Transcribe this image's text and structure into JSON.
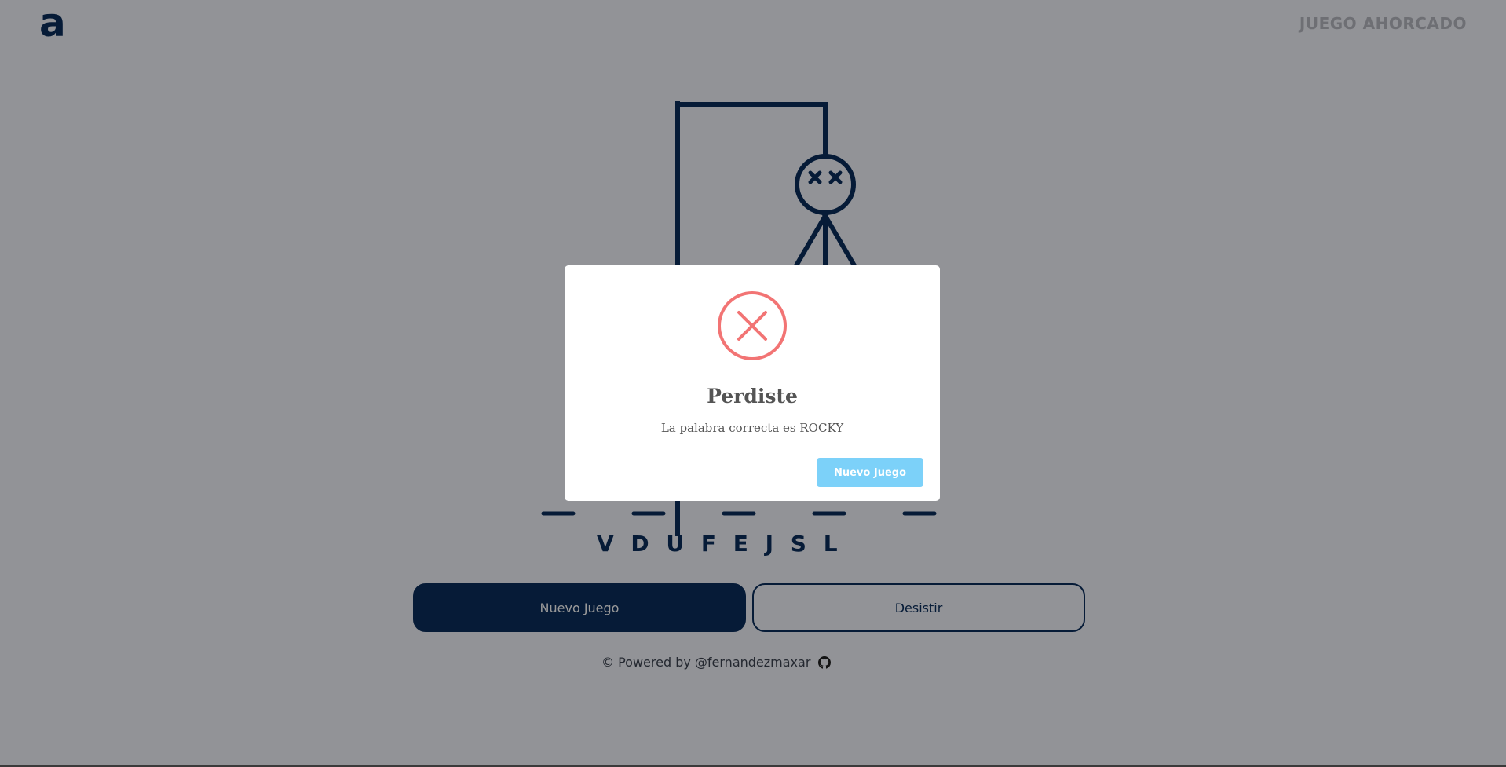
{
  "header": {
    "logo": "a",
    "title": "JUEGO AHORCADO"
  },
  "game": {
    "word_length": 5,
    "wrong_letters": "VDUFEJSL",
    "buttons": {
      "new_game": "Nuevo Juego",
      "give_up": "Desistir"
    }
  },
  "footer": {
    "text": "© Powered by @fernandezmaxar",
    "icon": "github-icon"
  },
  "modal": {
    "icon": "error-x-icon",
    "title": "Perdiste",
    "text": "La palabra correcta es ROCKY",
    "button": "Nuevo Juego"
  },
  "colors": {
    "primary": "#0a2e5c",
    "error": "#f27474",
    "confirm_button": "#7cd1f9"
  }
}
